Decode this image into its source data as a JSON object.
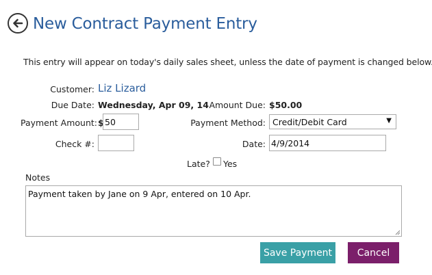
{
  "header": {
    "title": "New Contract Payment Entry",
    "back_icon": "arrow-left-circle-icon"
  },
  "intro_text": "This entry will appear on today's daily sales sheet, unless the date of payment is changed below.",
  "customer": {
    "label": "Customer:",
    "name": "Liz Lizard"
  },
  "due_date": {
    "label": "Due Date:",
    "value": "Wednesday, Apr 09, 14"
  },
  "amount_due": {
    "label": "Amount Due:",
    "value": "$50.00"
  },
  "payment_amount": {
    "label": "Payment Amount:",
    "currency": "$",
    "value": "50"
  },
  "payment_method": {
    "label": "Payment Method:",
    "selected": "Credit/Debit Card"
  },
  "check_number": {
    "label": "Check #:",
    "value": ""
  },
  "date": {
    "label": "Date:",
    "value": "4/9/2014"
  },
  "late": {
    "label": "Late?",
    "option": "Yes",
    "checked": false
  },
  "notes": {
    "label": "Notes",
    "value": "Payment taken by Jane on 9 Apr, entered on 10 Apr."
  },
  "actions": {
    "save_label": "Save Payment",
    "cancel_label": "Cancel"
  },
  "colors": {
    "title": "#2a5d9c",
    "link": "#2a5d9c",
    "save_button": "#3aa0a6",
    "cancel_button": "#7b1f6a"
  }
}
